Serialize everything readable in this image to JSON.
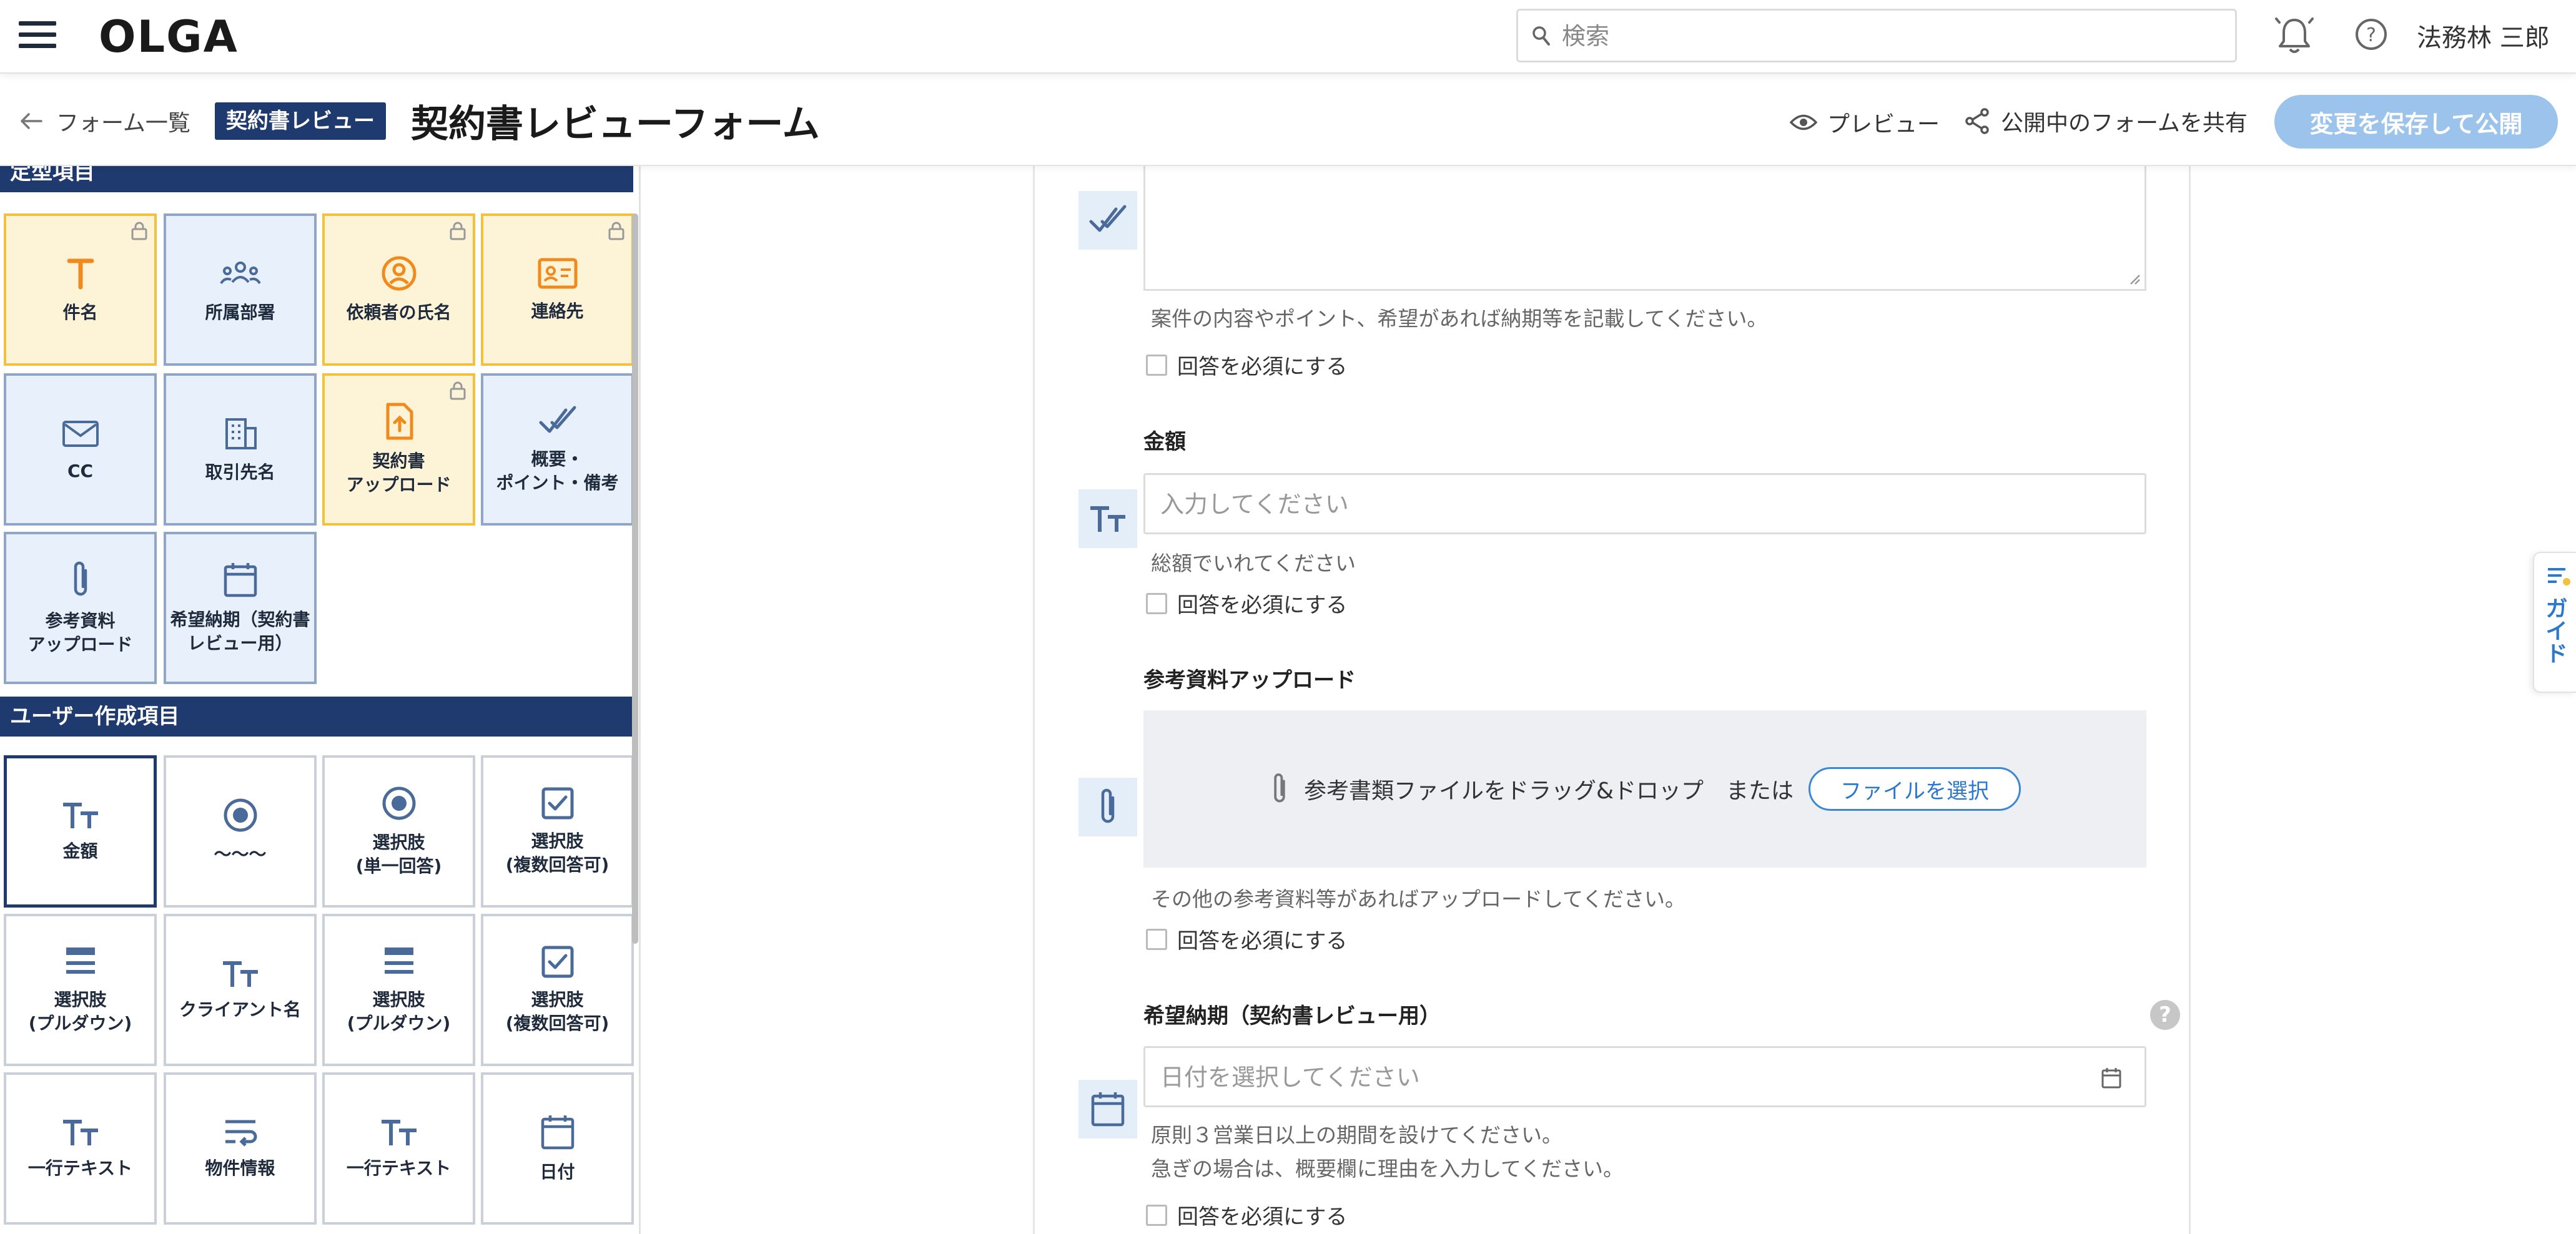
{
  "header": {
    "logo": "OLGA",
    "search_placeholder": "検索",
    "user_name": "法務林 三郎"
  },
  "subheader": {
    "back_label": "フォーム一覧",
    "badge": "契約書レビュー",
    "title": "契約書レビューフォーム",
    "preview_label": "プレビュー",
    "share_label": "公開中のフォームを共有",
    "publish_label": "変更を保存して公開"
  },
  "palette": {
    "standard_section": "定型項目",
    "standard_items": [
      {
        "label": "件名",
        "icon": "text-t-icon",
        "locked": true
      },
      {
        "label": "所属部署",
        "icon": "team-icon",
        "locked": false
      },
      {
        "label": "依頼者の氏名",
        "icon": "person-circle-icon",
        "locked": true
      },
      {
        "label": "連絡先",
        "icon": "contact-card-icon",
        "locked": true
      },
      {
        "label": "CC",
        "icon": "mail-icon",
        "locked": false
      },
      {
        "label": "取引先名",
        "icon": "building-icon",
        "locked": false
      },
      {
        "label": "契約書\nアップロード",
        "icon": "file-upload-icon",
        "locked": true
      },
      {
        "label": "概要・\nポイント・備考",
        "icon": "double-check-icon",
        "locked": false
      },
      {
        "label": "参考資料\nアップロード",
        "icon": "paperclip-icon",
        "locked": false
      },
      {
        "label": "希望納期（契約書\nレビュー用）",
        "icon": "calendar-icon",
        "locked": false
      }
    ],
    "user_section": "ユーザー作成項目",
    "user_items": [
      {
        "label": "金額",
        "icon": "text-size-icon"
      },
      {
        "label": "〜〜〜",
        "icon": "radio-icon"
      },
      {
        "label": "選択肢\n(単一回答)",
        "icon": "radio-icon"
      },
      {
        "label": "選択肢\n(複数回答可)",
        "icon": "checkbox-icon"
      },
      {
        "label": "選択肢\n(プルダウン)",
        "icon": "dropdown-list-icon"
      },
      {
        "label": "クライアント名",
        "icon": "text-size-icon"
      },
      {
        "label": "選択肢\n(プルダウン)",
        "icon": "dropdown-list-icon"
      },
      {
        "label": "選択肢\n(複数回答可)",
        "icon": "checkbox-icon"
      },
      {
        "label": "一行テキスト",
        "icon": "text-size-icon"
      },
      {
        "label": "物件情報",
        "icon": "wrap-text-icon"
      },
      {
        "label": "一行テキスト",
        "icon": "text-size-icon"
      },
      {
        "label": "日付",
        "icon": "calendar-icon"
      }
    ]
  },
  "form": {
    "summary": {
      "help": "案件の内容やポイント、希望があれば納期等を記載してください。",
      "required_label": "回答を必須にする"
    },
    "amount": {
      "title": "金額",
      "placeholder": "入力してください",
      "help": "総額でいれてください",
      "required_label": "回答を必須にする"
    },
    "reference_upload": {
      "title": "参考資料アップロード",
      "drop_text": "参考書類ファイルをドラッグ&ドロップ　または",
      "button": "ファイルを選択",
      "help": "その他の参考資料等があればアップロードしてください。",
      "required_label": "回答を必須にする"
    },
    "due_date": {
      "title": "希望納期（契約書レビュー用）",
      "placeholder": "日付を選択してください",
      "help_line1": "原則３営業日以上の期間を設けてください。",
      "help_line2": "急ぎの場合は、概要欄に理由を入力してください。",
      "required_label": "回答を必須にする",
      "help_badge": "?"
    }
  },
  "guide_tab": {
    "label": "ガイド"
  },
  "colors": {
    "navy": "#1f3a6e",
    "accent_blue": "#2c79cc",
    "publish_button": "#9cc3ec",
    "locked_tile_border": "#f2c23c",
    "locked_tile_bg": "#fdf4d8",
    "tile_bg": "#e8f1fb"
  }
}
